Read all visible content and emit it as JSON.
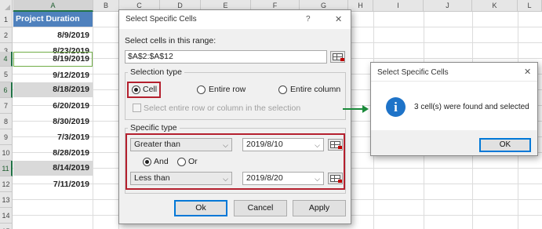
{
  "spreadsheet": {
    "columns": [
      "A",
      "B",
      "C",
      "D",
      "E",
      "F",
      "G",
      "H",
      "I",
      "J",
      "K",
      "L"
    ],
    "rows": [
      "1",
      "2",
      "3",
      "4",
      "5",
      "6",
      "7",
      "8",
      "9",
      "10",
      "11",
      "12",
      "13",
      "14",
      "15"
    ],
    "header_cell": "Project Duration",
    "values": [
      "8/9/2019",
      "8/23/2019",
      "8/19/2019",
      "9/12/2019",
      "8/18/2019",
      "6/20/2019",
      "8/30/2019",
      "7/3/2019",
      "8/28/2019",
      "8/14/2019",
      "7/11/2019"
    ]
  },
  "dialog": {
    "title": "Select Specific Cells",
    "help": "?",
    "close": "✕",
    "range_label": "Select cells in this range:",
    "range_value": "$A$2:$A$12",
    "selection_type": {
      "label": "Selection type",
      "options": [
        "Cell",
        "Entire row",
        "Entire column"
      ],
      "selected": "Cell",
      "checkbox_label": "Select entire row or column in the selection"
    },
    "specific_type": {
      "label": "Specific type",
      "condition1": "Greater than",
      "value1": "2019/8/10",
      "and_label": "And",
      "or_label": "Or",
      "logic_selected": "And",
      "condition2": "Less than",
      "value2": "2019/8/20"
    },
    "buttons": {
      "ok": "Ok",
      "cancel": "Cancel",
      "apply": "Apply"
    }
  },
  "message": {
    "title": "Select Specific Cells",
    "close": "✕",
    "text": "3 cell(s) were found and selected",
    "ok": "OK"
  },
  "colors": {
    "accent_red": "#b4202e",
    "arrow_green": "#1a8a3a",
    "header_blue": "#4f81bd",
    "info_blue": "#1e73c8"
  }
}
